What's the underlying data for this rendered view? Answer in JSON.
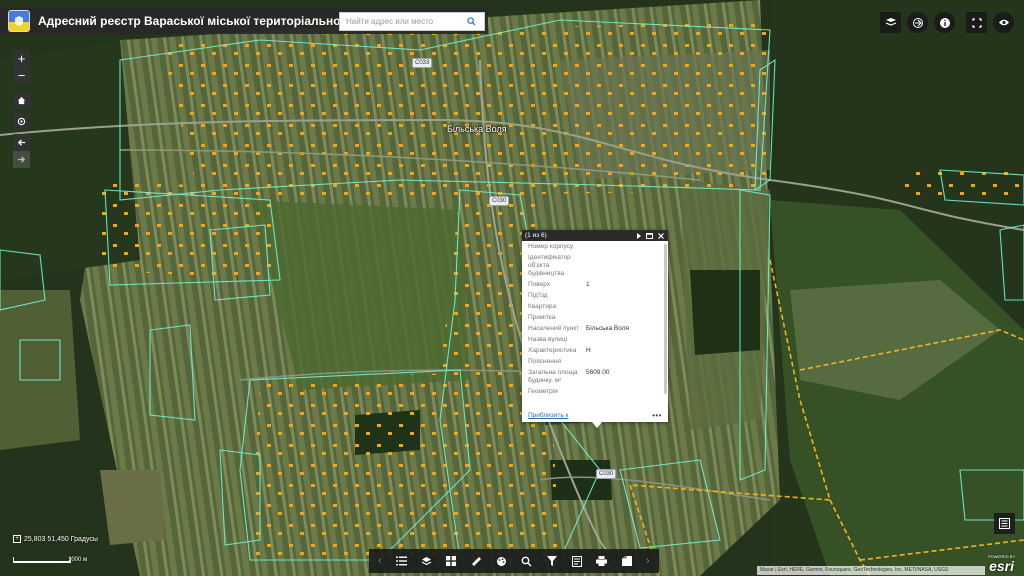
{
  "header": {
    "title": "Адресний реєстр Вараської міської територіальної громади",
    "search_placeholder": "Найти адрес или место"
  },
  "map": {
    "place_label": "Більська Воля",
    "road_shields": [
      "C033",
      "C030",
      "C030"
    ]
  },
  "popup": {
    "counter": "(1 из 6)",
    "fields": [
      {
        "label": "Номер корпусу",
        "value": ""
      },
      {
        "label": "Ідентифікатор об'єкта будівництва",
        "value": ""
      },
      {
        "label": "Поверх",
        "value": "1"
      },
      {
        "label": "Під'їзд",
        "value": ""
      },
      {
        "label": "Квартира",
        "value": ""
      },
      {
        "label": "Примітка",
        "value": ""
      },
      {
        "label": "Населений пункт",
        "value": "Більська Воля"
      },
      {
        "label": "Назва вулиці",
        "value": ""
      },
      {
        "label": "Характеристика",
        "value": "Н"
      },
      {
        "label": "Пояснення",
        "value": ""
      },
      {
        "label": "Загальна площа будинку, м²",
        "value": "5609.00"
      },
      {
        "label": "Геометрія",
        "value": ""
      }
    ],
    "zoom_link": "Приблизить к",
    "more": "•••"
  },
  "coords": "25,803 51,450 Градусы",
  "scale_label": "1000 м",
  "attribution": "Maxar | Esri, HERE, Garmin, Foursquare, GeoTechnologies, Inc, METI/NASA, USGS",
  "powered_by": "POWERED BY",
  "esri": "esri",
  "icons": {
    "zoom_in": "plus-icon",
    "zoom_out": "minus-icon",
    "home": "home-icon",
    "locate": "locate-icon",
    "back": "arrow-left-icon",
    "forward": "arrow-right-icon"
  }
}
